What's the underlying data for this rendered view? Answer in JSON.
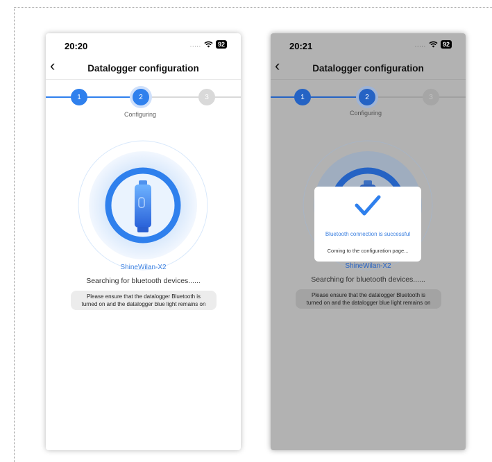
{
  "colors": {
    "accent": "#2f80ed",
    "step_inactive": "#d9d9d9",
    "overlay_gray": "#b2b2b2"
  },
  "screens": [
    {
      "status_time": "20:20",
      "battery": "92",
      "title": "Datalogger configuration",
      "steps": [
        "1",
        "2",
        "3"
      ],
      "step_label": "Configuring",
      "device_name": "ShineWilan-X2",
      "searching_text": "Searching for bluetooth devices......",
      "tip_line1": "Please ensure that the datalogger Bluetooth is",
      "tip_line2": "turned on and the datalogger blue light remains on"
    },
    {
      "status_time": "20:21",
      "battery": "92",
      "title": "Datalogger configuration",
      "steps": [
        "1",
        "2",
        "3"
      ],
      "step_label": "Configuring",
      "device_name": "ShineWilan-X2",
      "searching_text": "Searching for bluetooth devices......",
      "tip_line1": "Please ensure that the datalogger Bluetooth is",
      "tip_line2": "turned on and the datalogger blue light remains on",
      "modal": {
        "message": "Bluetooth connection is successful",
        "sub_message": "Coming to the configuration page..."
      }
    }
  ]
}
